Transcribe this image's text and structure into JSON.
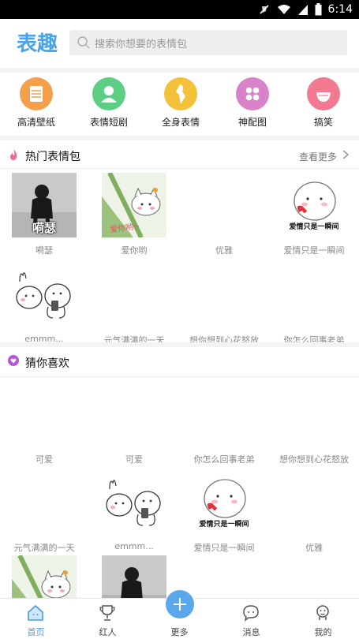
{
  "status_bar": {
    "time": "6:14"
  },
  "header": {
    "logo_text": "表趣",
    "search_placeholder": "搜索你想要的表情包"
  },
  "categories": [
    {
      "label": "高清壁纸",
      "color": "#f4a04a",
      "icon": "wallpaper-icon"
    },
    {
      "label": "表情短剧",
      "color": "#5dcf84",
      "icon": "drama-icon"
    },
    {
      "label": "全身表情",
      "color": "#f3c23a",
      "icon": "body-icon"
    },
    {
      "label": "神配图",
      "color": "#d883c9",
      "icon": "grid-icon"
    },
    {
      "label": "搞笑",
      "color": "#f27a90",
      "icon": "smile-icon"
    }
  ],
  "hot": {
    "title": "热门表情包",
    "more": "查看更多",
    "items": [
      {
        "caption": "嗬瑟",
        "thumb": "dark",
        "overlay": "嗬瑟"
      },
      {
        "caption": "爱你哟",
        "thumb": "cat",
        "overlay": "爱你哟~"
      },
      {
        "caption": "优雅",
        "thumb": "blank",
        "overlay": ""
      },
      {
        "caption": "爱情只是一瞬间",
        "thumb": "bun",
        "overlay": "爱情只是一瞬间"
      },
      {
        "caption": "emmm...",
        "thumb": "rabbits",
        "overlay": ""
      },
      {
        "caption": "元气满满的一天",
        "thumb": "blank",
        "overlay": ""
      },
      {
        "caption": "想你想到心花怒放",
        "thumb": "blank",
        "overlay": ""
      },
      {
        "caption": "你怎么回事老弟",
        "thumb": "blank",
        "overlay": ""
      }
    ]
  },
  "guess": {
    "title": "猜你喜欢",
    "items": [
      {
        "caption": "可爱",
        "thumb": "blank",
        "overlay": ""
      },
      {
        "caption": "可爱",
        "thumb": "blank",
        "overlay": ""
      },
      {
        "caption": "你怎么回事老弟",
        "thumb": "blank",
        "overlay": ""
      },
      {
        "caption": "想你想到心花怒放",
        "thumb": "blank",
        "overlay": ""
      },
      {
        "caption": "元气满满的一天",
        "thumb": "blank",
        "overlay": ""
      },
      {
        "caption": "emmm...",
        "thumb": "rabbits",
        "overlay": ""
      },
      {
        "caption": "爱情只是一瞬间",
        "thumb": "bun",
        "overlay": "爱情只是一瞬间"
      },
      {
        "caption": "优雅",
        "thumb": "blank",
        "overlay": ""
      },
      {
        "caption": "",
        "thumb": "cat",
        "overlay": ""
      },
      {
        "caption": "",
        "thumb": "dark",
        "overlay": ""
      }
    ]
  },
  "nav": {
    "tabs": [
      {
        "label": "首页",
        "icon": "home-icon",
        "active": true
      },
      {
        "label": "红人",
        "icon": "trophy-icon",
        "active": false
      },
      {
        "label": "更多",
        "icon": "plus-icon",
        "active": false
      },
      {
        "label": "消息",
        "icon": "message-icon",
        "active": false
      },
      {
        "label": "我的",
        "icon": "profile-icon",
        "active": false
      }
    ]
  },
  "colors": {
    "accent": "#5aa8ea",
    "logo": "#4aa3e6",
    "hot_icon": "#f06a8a",
    "guess_icon": "#b457d8"
  }
}
